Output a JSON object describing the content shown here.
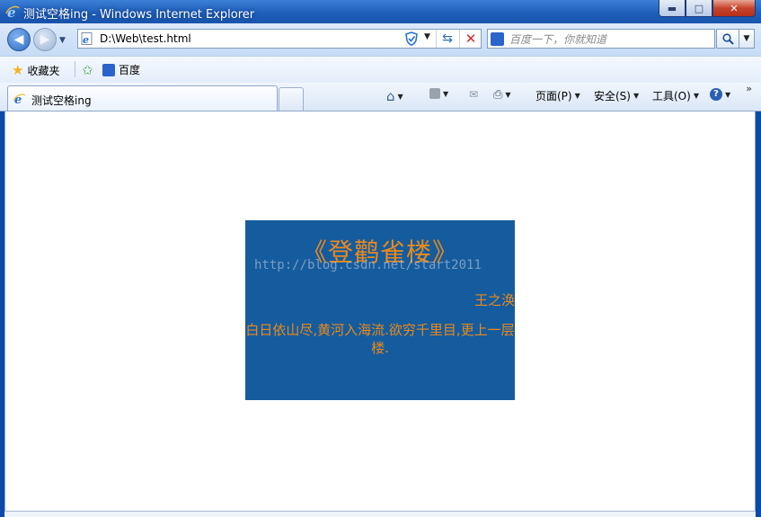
{
  "window": {
    "title": "测试空格ing - Windows Internet Explorer",
    "min_symbol": "▬",
    "max_symbol": "□",
    "close_symbol": "✕"
  },
  "nav": {
    "address": "D:\\Web\\test.html",
    "search_placeholder": "百度一下，你就知道"
  },
  "favorites": {
    "label": "收藏夹",
    "items": [
      {
        "label": "百度"
      }
    ]
  },
  "tabs": [
    {
      "label": "测试空格ing"
    }
  ],
  "commands": {
    "page": "页面(P)",
    "safety": "安全(S)",
    "tools": "工具(O)"
  },
  "page": {
    "background_color": "#155c9e",
    "text_color": "#e9891b",
    "title": "《登鹳雀楼》",
    "watermark": "http://blog.csdn.net/start2011",
    "author": "王之涣",
    "verse": "白日依山尽,黄河入海流.欲穷千里目,更上一层楼."
  }
}
